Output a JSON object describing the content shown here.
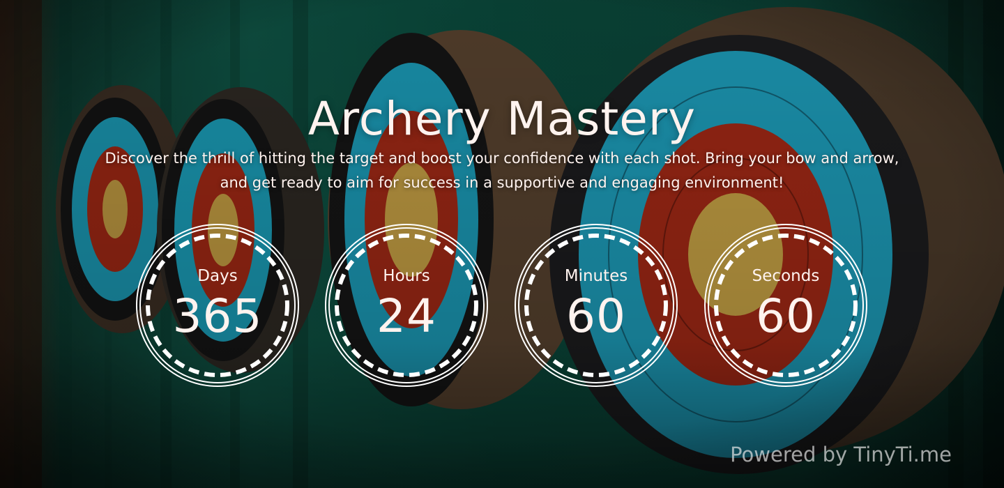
{
  "page": {
    "title": "Archery Mastery",
    "description": "Discover the thrill of hitting the target and boost your confidence with each shot. Bring your bow and arrow, and get ready to aim for success in a supportive and engaging environment!"
  },
  "countdown": [
    {
      "label": "Days",
      "value": "365"
    },
    {
      "label": "Hours",
      "value": "24"
    },
    {
      "label": "Minutes",
      "value": "60"
    },
    {
      "label": "Seconds",
      "value": "60"
    }
  ],
  "footer": {
    "powered_by": "Powered by TinyTi.me"
  },
  "theme": {
    "text_color": "#fff3ef",
    "ring_color": "#ffffff",
    "curtain_green": "#0e5a48",
    "target_blue": "#1e9fbb",
    "target_red": "#a22917",
    "target_gold": "#c9a244"
  },
  "background": {
    "icon": "archery-targets-photo"
  }
}
